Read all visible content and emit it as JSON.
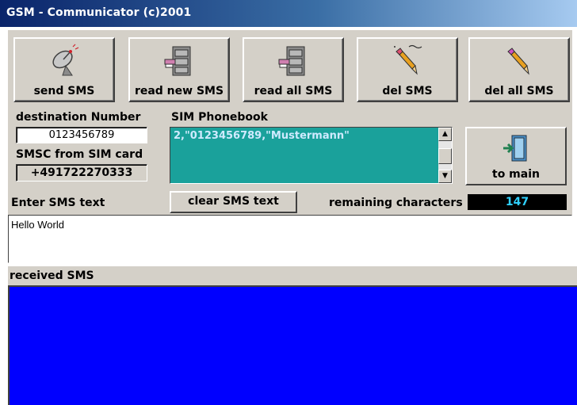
{
  "window": {
    "title": "GSM - Communicator (c)2001"
  },
  "toolbar": {
    "buttons": [
      {
        "label": "send SMS",
        "icon": "satellite-dish-icon"
      },
      {
        "label": "read new SMS",
        "icon": "filing-cabinet-icon"
      },
      {
        "label": "read all SMS",
        "icon": "filing-cabinet-icon"
      },
      {
        "label": "del SMS",
        "icon": "eraser-pencil-icon"
      },
      {
        "label": "del all SMS",
        "icon": "eraser-pencil-icon"
      }
    ]
  },
  "destination": {
    "label": "destination Number",
    "value": "0123456789"
  },
  "smsc": {
    "label": "SMSC from SIM card",
    "value": "+491722270333"
  },
  "phonebook": {
    "label": "SIM Phonebook",
    "entries": [
      "2,\"0123456789,\"Mustermann\""
    ]
  },
  "to_main": {
    "label": "to main",
    "icon": "exit-door-icon"
  },
  "compose": {
    "label": "Enter SMS text",
    "clear_label": "clear SMS text",
    "remaining_label": "remaining characters",
    "remaining_value": "147",
    "text": "Hello World"
  },
  "received": {
    "label": "received SMS",
    "text": ""
  },
  "colors": {
    "phonebook_bg": "#1aa19b",
    "received_bg": "#0000ff",
    "counter_text": "#2fd0ff",
    "panel": "#d4d0c8"
  }
}
